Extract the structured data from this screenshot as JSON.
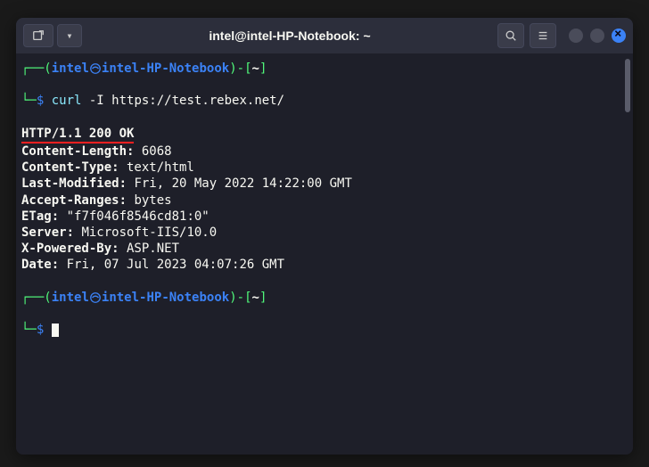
{
  "titlebar": {
    "title": "intel@intel-HP-Notebook: ~"
  },
  "prompt": {
    "open_bracket": "(",
    "user": "intel",
    "at_host": "intel-HP-Notebook",
    "close_bracket": ")",
    "dash": "-",
    "path_open": "[",
    "path": "~",
    "path_close": "]",
    "symbol": "$"
  },
  "command": {
    "cmd": "curl",
    "args": " -I https://test.rebex.net/"
  },
  "response": {
    "status_line": "HTTP/1.1 200 OK",
    "headers": [
      {
        "key": "Content-Length:",
        "value": " 6068"
      },
      {
        "key": "Content-Type:",
        "value": " text/html"
      },
      {
        "key": "Last-Modified:",
        "value": " Fri, 20 May 2022 14:22:00 GMT"
      },
      {
        "key": "Accept-Ranges:",
        "value": " bytes"
      },
      {
        "key": "ETag:",
        "value": " \"f7f046f8546cd81:0\""
      },
      {
        "key": "Server:",
        "value": " Microsoft-IIS/10.0"
      },
      {
        "key": "X-Powered-By:",
        "value": " ASP.NET"
      },
      {
        "key": "Date:",
        "value": " Fri, 07 Jul 2023 04:07:26 GMT"
      }
    ]
  }
}
